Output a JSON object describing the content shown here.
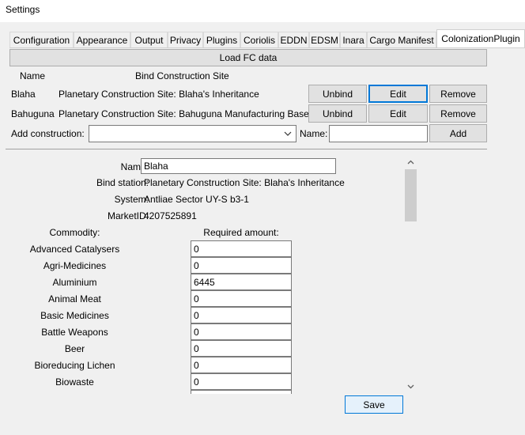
{
  "window": {
    "title": "Settings"
  },
  "tabs": [
    {
      "label": "Configuration"
    },
    {
      "label": "Appearance"
    },
    {
      "label": "Output"
    },
    {
      "label": "Privacy"
    },
    {
      "label": "Plugins"
    },
    {
      "label": "Coriolis"
    },
    {
      "label": "EDDN"
    },
    {
      "label": "EDSM"
    },
    {
      "label": "Inara"
    },
    {
      "label": "Cargo Manifest"
    },
    {
      "label": "ColonizationPlugin",
      "active": true
    }
  ],
  "toolbar": {
    "load_fc_label": "Load FC data"
  },
  "bindings": {
    "header_name": "Name",
    "header_site": "Bind Construction Site",
    "rows": [
      {
        "name": "Blaha",
        "site": "Planetary Construction Site: Blaha's Inheritance",
        "unbind": "Unbind",
        "edit": "Edit",
        "remove": "Remove"
      },
      {
        "name": "Bahuguna",
        "site": "Planetary Construction Site: Bahuguna Manufacturing Base",
        "unbind": "Unbind",
        "edit": "Edit",
        "remove": "Remove"
      }
    ]
  },
  "add_construction": {
    "label": "Add construction:",
    "select_value": "",
    "name_label": "Name:",
    "name_value": "",
    "add_label": "Add"
  },
  "details": {
    "name_label": "Name:",
    "name_value": "Blaha",
    "bind_station_label": "Bind station:",
    "bind_station_value": "Planetary Construction Site: Blaha's Inheritance",
    "system_label": "System:",
    "system_value": "Antliae Sector UY-S b3-1",
    "market_label": "MarketID:",
    "market_value": "4207525891",
    "commodity_header": "Commodity:",
    "required_header": "Required amount:",
    "commodities": [
      {
        "name": "Advanced Catalysers",
        "amount": "0"
      },
      {
        "name": "Agri-Medicines",
        "amount": "0"
      },
      {
        "name": "Aluminium",
        "amount": "6445"
      },
      {
        "name": "Animal Meat",
        "amount": "0"
      },
      {
        "name": "Basic Medicines",
        "amount": "0"
      },
      {
        "name": "Battle Weapons",
        "amount": "0"
      },
      {
        "name": "Beer",
        "amount": "0"
      },
      {
        "name": "Bioreducing Lichen",
        "amount": "0"
      },
      {
        "name": "Biowaste",
        "amount": "0"
      },
      {
        "name": "",
        "amount": ""
      }
    ]
  },
  "save_label": "Save",
  "icons": {
    "dropdown": "chevron-down-icon",
    "scroll_up": "chevron-up-icon",
    "scroll_down": "chevron-down-icon"
  }
}
